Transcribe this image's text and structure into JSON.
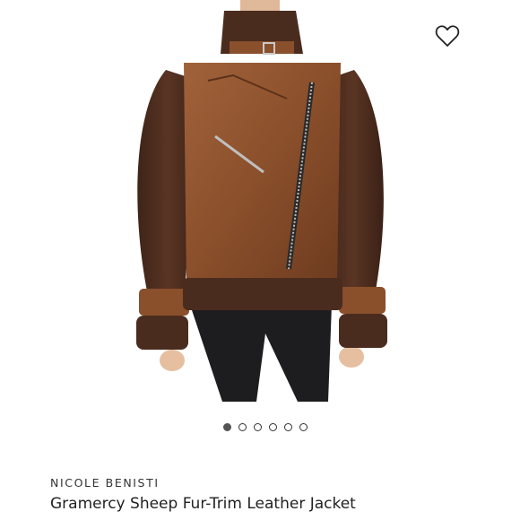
{
  "product": {
    "brand": "NICOLE BENISTI",
    "title": "Gramercy Sheep Fur-Trim Leather Jacket",
    "image_alt": "Gramercy Sheep Fur-Trim Leather Jacket",
    "wishlist_icon": "heart-outline-icon"
  },
  "carousel": {
    "count": 6,
    "active_index": 0
  },
  "colors": {
    "leather": "#8a4f2b",
    "fur": "#4a2c1f",
    "pants": "#1d1d1f",
    "text": "#222222"
  }
}
